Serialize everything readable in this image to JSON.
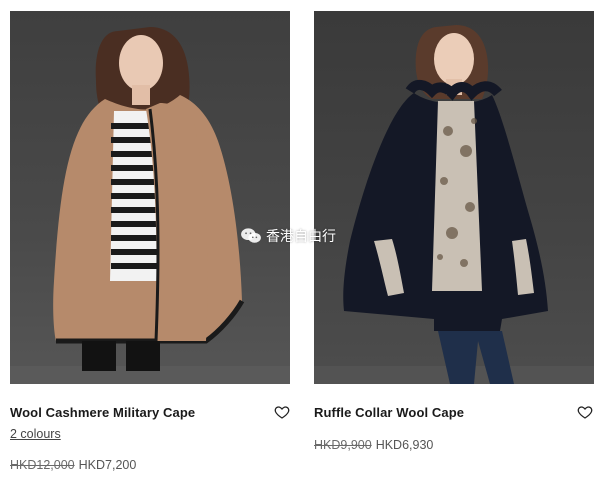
{
  "products": [
    {
      "name": "Wool Cashmere Military Cape",
      "colours_label": "2 colours",
      "old_price": "HKD12,000",
      "price": "HKD7,200"
    },
    {
      "name": "Ruffle Collar Wool Cape",
      "old_price": "HKD9,900",
      "price": "HKD6,930"
    }
  ],
  "watermark": {
    "text": "香港自由行"
  },
  "icons": {
    "wishlist": "heart-outline-icon",
    "watermark_logo": "wechat-icon"
  },
  "colors": {
    "text": "#1a1a1a",
    "camel_cape": "#b68a6b",
    "navy_cape": "#141826"
  }
}
